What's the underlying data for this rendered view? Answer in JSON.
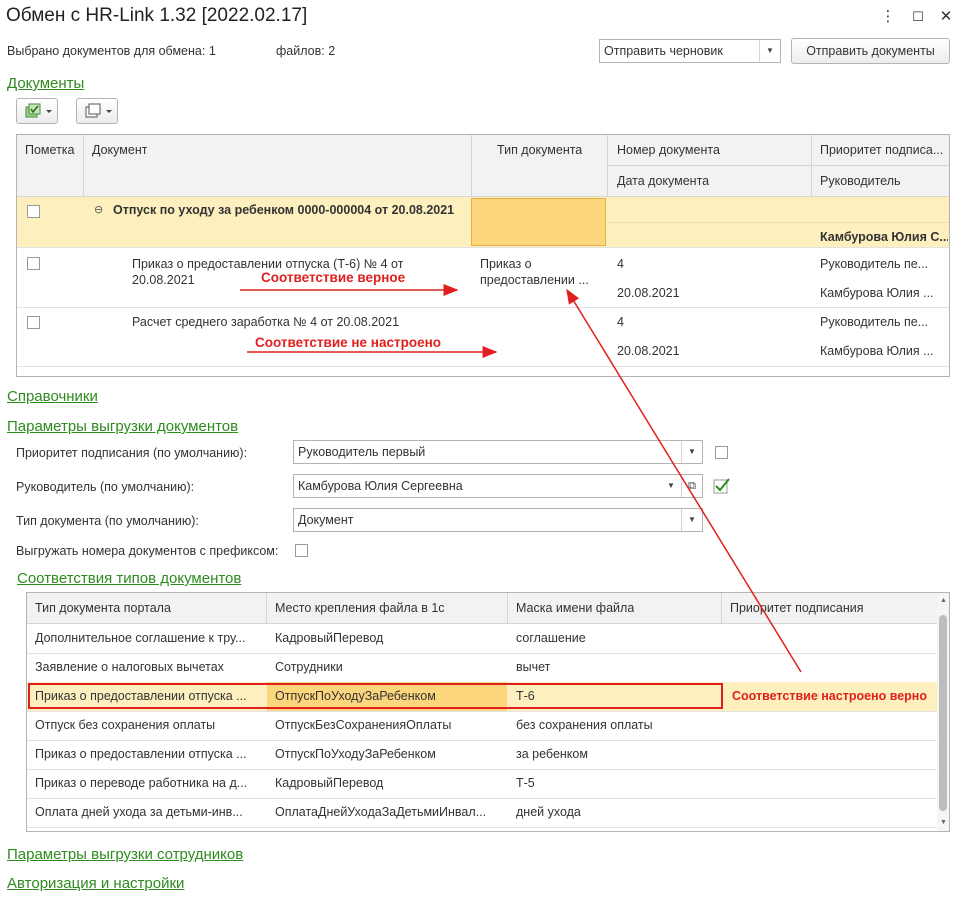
{
  "window": {
    "title": "Обмен с HR-Link 1.32 [2022.02.17]",
    "menu_icon": "⋮",
    "maximize_icon": "☐",
    "close_icon": "✕"
  },
  "summary": {
    "selected_label": "Выбрано документов для обмена:",
    "selected_count": "1",
    "files_label": "файлов:",
    "files_count": "2",
    "mode_value": "Отправить черновик",
    "send_button": "Отправить документы"
  },
  "sections": {
    "documents": "Документы",
    "directories": "Справочники",
    "export_params": "Параметры выгрузки документов",
    "type_matches": "Соответствия типов документов",
    "employee_params": "Параметры выгрузки сотрудников",
    "auth": "Авторизация и настройки"
  },
  "documents_table": {
    "headers": {
      "mark": "Пометка",
      "document": "Документ",
      "doc_type": "Тип документа",
      "doc_number": "Номер документа",
      "doc_date": "Дата документа",
      "priority": "Приоритет подписа...",
      "manager": "Руководитель"
    },
    "group_row": {
      "expand_icon": "⊖",
      "document": "Отпуск по уходу за ребенком 0000-000004 от 20.08.2021",
      "manager": "Камбурова Юлия С..."
    },
    "rows": [
      {
        "document_line1": "Приказ о предоставлении отпуска (Т-6) № 4 от",
        "document_line2": "20.08.2021",
        "type_line1": "Приказ о",
        "type_line2": "предоставлении ...",
        "number": "4",
        "date": "20.08.2021",
        "priority": "Руководитель пе...",
        "manager": "Камбурова Юлия ..."
      },
      {
        "document_line1": "Расчет среднего заработка № 4 от 20.08.2021",
        "number": "4",
        "date": "20.08.2021",
        "priority": "Руководитель пе...",
        "manager": "Камбурова Юлия ..."
      }
    ]
  },
  "annotations": {
    "correct": "Соответствие верное",
    "not_configured": "Соответствие не настроено",
    "configured_correctly": "Соответствие настроено верно"
  },
  "export_params": {
    "priority_label": "Приоритет подписания (по умолчанию):",
    "priority_value": "Руководитель первый",
    "manager_label": "Руководитель (по умолчанию):",
    "manager_value": "Камбурова Юлия Сергеевна",
    "doctype_label": "Тип документа (по умолчанию):",
    "doctype_value": "Документ",
    "prefix_label": "Выгружать номера документов с префиксом:"
  },
  "matches_table": {
    "headers": {
      "portal_type": "Тип документа портала",
      "place": "Место крепления файла в 1с",
      "mask": "Маска имени файла",
      "priority": "Приоритет подписания"
    },
    "rows": [
      {
        "portal_type": "Дополнительное соглашение к тру...",
        "place": "КадровыйПеревод",
        "mask": "соглашение"
      },
      {
        "portal_type": "Заявление о налоговых вычетах",
        "place": "Сотрудники",
        "mask": "вычет"
      },
      {
        "portal_type": "Приказ о предоставлении отпуска ...",
        "place": "ОтпускПоУходуЗаРебенком",
        "mask": "Т-6"
      },
      {
        "portal_type": "Отпуск без сохранения оплаты",
        "place": "ОтпускБезСохраненияОплаты",
        "mask": "без сохранения оплаты"
      },
      {
        "portal_type": "Приказ о предоставлении отпуска ...",
        "place": "ОтпускПоУходуЗаРебенком",
        "mask": "за ребенком"
      },
      {
        "portal_type": "Приказ о переводе работника на д...",
        "place": "КадровыйПеревод",
        "mask": "Т-5"
      },
      {
        "portal_type": "Оплата дней ухода за детьми-инв...",
        "place": "ОплатаДнейУходаЗаДетьмиИнвал...",
        "mask": "дней ухода"
      }
    ]
  },
  "colors": {
    "section_green": "#2e8b1e",
    "annotation_red": "#e0201f",
    "selected_row": "#fdf0be",
    "selected_cell": "#fbd67c"
  }
}
